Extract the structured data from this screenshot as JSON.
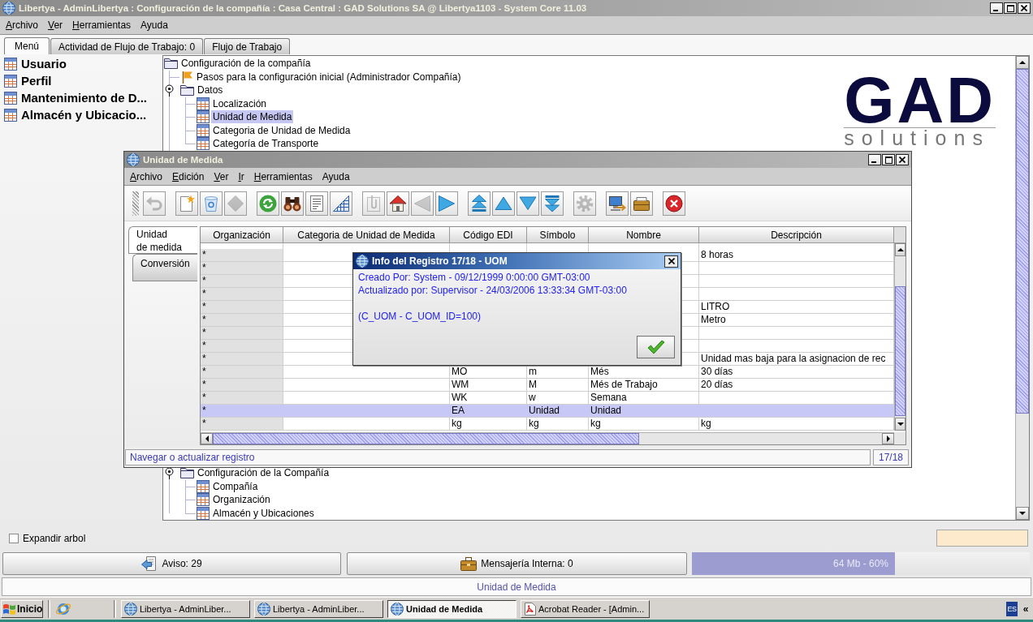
{
  "window": {
    "title": "Libertya - AdminLibertya : Configuración de la compañía : Casa Central : GAD Solutions SA @ Libertya1103 - System Core 11.03"
  },
  "menu_bar": [
    {
      "label": "Archivo",
      "mnemonic": true
    },
    {
      "label": "Ver",
      "mnemonic": true
    },
    {
      "label": "Herramientas",
      "mnemonic": true
    },
    {
      "label": "Ayuda",
      "mnemonic": false
    }
  ],
  "tabs": [
    {
      "label": "Menú",
      "selected": true
    },
    {
      "label": "Actividad de Flujo de Trabajo: 0",
      "selected": false
    },
    {
      "label": "Flujo de Trabajo",
      "selected": false
    }
  ],
  "sidebar": {
    "items": [
      "Usuario",
      "Perfil",
      "Mantenimiento de D...",
      "Almacén y Ubicacio..."
    ]
  },
  "tree": {
    "label": "Configuración de la compañía",
    "kind": "folder",
    "selected": false,
    "children": [
      {
        "label": "Pasos para la configuración inicial (Administrador Compañía)",
        "kind": "workflow",
        "selected": false
      },
      {
        "label": "Datos",
        "kind": "folder",
        "expanded": true,
        "selected": false,
        "children": [
          {
            "label": "Localización",
            "kind": "window",
            "selected": false
          },
          {
            "label": "Unidad de Medida",
            "kind": "window",
            "selected": true
          },
          {
            "label": "Categoria de Unidad de Medida",
            "kind": "window",
            "selected": false
          },
          {
            "label": "Categoría de Transporte",
            "kind": "window",
            "selected": false
          }
        ]
      },
      {
        "label": "Configuración de la Compañía",
        "kind": "folder",
        "expanded": true,
        "selected": false,
        "children": [
          {
            "label": "Compañía",
            "kind": "window",
            "selected": false
          },
          {
            "label": "Organización",
            "kind": "window",
            "selected": false
          },
          {
            "label": "Almacén y Ubicaciones",
            "kind": "window",
            "selected": false
          }
        ]
      }
    ]
  },
  "logo": {
    "mark": "GAD",
    "tagline": "solutions"
  },
  "expand_tree": {
    "label": "Expandir arbol",
    "checked": false
  },
  "status_buttons": [
    {
      "label": "Aviso: 29",
      "kind": "notice"
    },
    {
      "label": "Mensajería Interna: 0",
      "kind": "messages"
    }
  ],
  "memory": {
    "reading": "64 Mb - 60%",
    "level": 0.6
  },
  "status_line": {
    "text": "Unidad de Medida"
  },
  "record_window": {
    "title": "Unidad de Medida",
    "menu": [
      {
        "label": "Archivo",
        "mnemonic": true
      },
      {
        "label": "Edición",
        "mnemonic": true
      },
      {
        "label": "Ver",
        "mnemonic": true
      },
      {
        "label": "Ir",
        "mnemonic": true
      },
      {
        "label": "Herramientas",
        "mnemonic": true
      },
      {
        "label": "Ayuda",
        "mnemonic": false
      }
    ],
    "toolbar": [
      [
        {
          "kind": "undo",
          "disabled": true
        }
      ],
      [
        {
          "kind": "new",
          "disabled": false
        },
        {
          "kind": "delete",
          "disabled": false
        },
        {
          "kind": "save",
          "disabled": true
        }
      ],
      [
        {
          "kind": "refresh",
          "disabled": false
        },
        {
          "kind": "find",
          "disabled": false
        },
        {
          "kind": "history",
          "disabled": false
        },
        {
          "kind": "grid",
          "disabled": false
        }
      ],
      [
        {
          "kind": "attachment",
          "disabled": true
        },
        {
          "kind": "home",
          "disabled": false
        },
        {
          "kind": "parent",
          "disabled": true
        },
        {
          "kind": "detail",
          "disabled": false
        }
      ],
      [
        {
          "kind": "first",
          "disabled": false
        },
        {
          "kind": "previous",
          "disabled": false
        },
        {
          "kind": "next",
          "disabled": false
        },
        {
          "kind": "last",
          "disabled": false
        }
      ],
      [
        {
          "kind": "print",
          "disabled": true
        }
      ],
      [
        {
          "kind": "process",
          "disabled": false
        },
        {
          "kind": "archive",
          "disabled": false
        }
      ],
      [
        {
          "kind": "exit",
          "disabled": false
        }
      ]
    ],
    "tabs": [
      {
        "lines": [
          "Unidad",
          "de medida"
        ],
        "selected": true
      },
      {
        "lines": [
          "Conversión"
        ],
        "selected": false
      }
    ],
    "table": {
      "columns": [
        "Organización",
        "Categoria de Unidad de Medida",
        "Código EDI",
        "Símbolo",
        "Nombre",
        "Descripción"
      ],
      "rows": [
        {
          "organizacion": "*",
          "descripcion": "8 horas",
          "selected": false
        },
        {
          "organizacion": "*",
          "selected": false
        },
        {
          "organizacion": "*",
          "selected": false
        },
        {
          "organizacion": "*",
          "selected": false
        },
        {
          "organizacion": "*",
          "descripcion": "LITRO",
          "selected": false
        },
        {
          "organizacion": "*",
          "descripcion": "Metro",
          "selected": false
        },
        {
          "organizacion": "*",
          "selected": false
        },
        {
          "organizacion": "*",
          "selected": false
        },
        {
          "organizacion": "*",
          "descripcion": "Unidad mas baja para la asignacion de rec",
          "selected": false
        },
        {
          "organizacion": "*",
          "codigo_edi": "MO",
          "simbolo": "m",
          "nombre": "Més",
          "descripcion": "30 días",
          "selected": false
        },
        {
          "organizacion": "*",
          "codigo_edi": "WM",
          "simbolo": "M",
          "nombre": "Més de Trabajo",
          "descripcion": "20 días",
          "selected": false
        },
        {
          "organizacion": "*",
          "codigo_edi": "WK",
          "simbolo": "w",
          "nombre": "Semana",
          "selected": false
        },
        {
          "organizacion": "*",
          "codigo_edi": "EA",
          "simbolo": "Unidad",
          "nombre": "Unidad",
          "selected": true
        },
        {
          "organizacion": "*",
          "codigo_edi": "kg",
          "simbolo": "kg",
          "nombre": "kg",
          "descripcion": "kg",
          "selected": false
        }
      ]
    },
    "status": {
      "message": "Navegar o actualizar registro",
      "position": "17/18"
    }
  },
  "dialog": {
    "title": "Info del Registro 17/18 - UOM",
    "audit": [
      "Creado Por: System - 09/12/1999 0:00:00 GMT-03:00",
      "Actualizado por: Supervisor - 24/03/2006 13:33:34 GMT-03:00"
    ],
    "record_key": "(C_UOM - C_UOM_ID=100)"
  },
  "taskbar": {
    "start": "Inicio",
    "tasks": [
      {
        "label": "Libertya - AdminLiber...",
        "kind": "app",
        "selected": false
      },
      {
        "label": "Libertya - AdminLiber...",
        "kind": "app",
        "selected": false
      },
      {
        "label": "Unidad de Medida",
        "kind": "app",
        "selected": true
      },
      {
        "label": "Acrobat Reader - [Admin...",
        "kind": "reader",
        "selected": false
      }
    ],
    "language": "ES",
    "tray_toggle": "«"
  }
}
